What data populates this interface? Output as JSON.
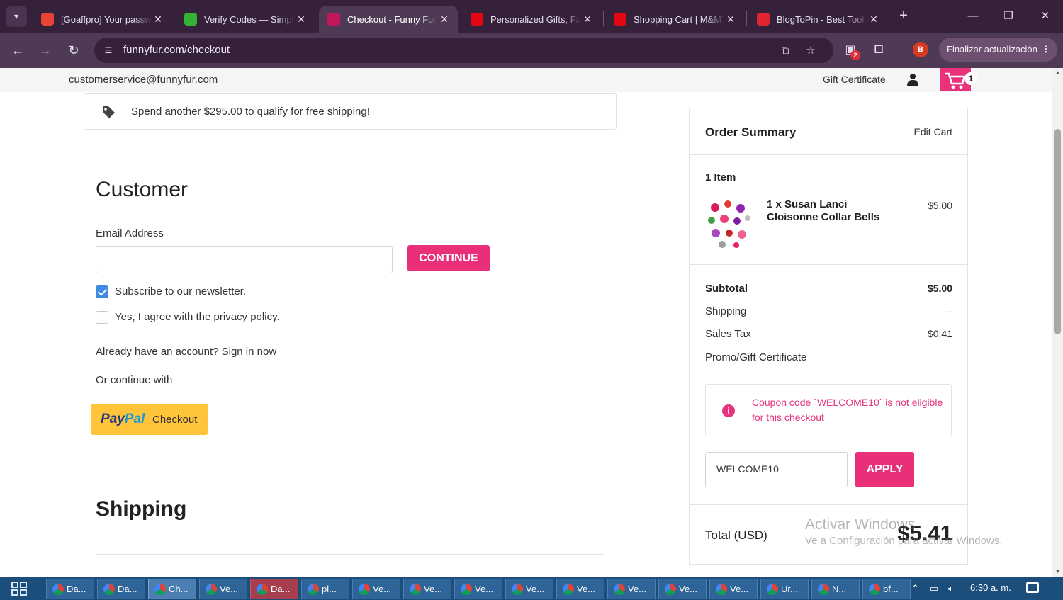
{
  "browser": {
    "tabs": [
      {
        "title": "[Goaffpro] Your password",
        "favicon": "gmail-icon",
        "color": "#ea4335",
        "active": false
      },
      {
        "title": "Verify Codes — SimplyCodes",
        "favicon": "simplycodes-icon",
        "color": "#34b233",
        "active": false
      },
      {
        "title": "Checkout - Funny Fur",
        "favicon": "funnyfur-icon",
        "color": "#c2185b",
        "active": true
      },
      {
        "title": "Personalized Gifts, Family",
        "favicon": "mm-icon",
        "color": "#e30613",
        "active": false
      },
      {
        "title": "Shopping Cart | M&M'S",
        "favicon": "mm-icon",
        "color": "#e30613",
        "active": false
      },
      {
        "title": "BlogToPin - Best Tool",
        "favicon": "blogtopin-icon",
        "color": "#e1252f",
        "active": false
      }
    ],
    "url": "funnyfur.com/checkout",
    "extension_badge": "2",
    "profile_initial": "B",
    "update_button": "Finalizar actualización"
  },
  "site": {
    "contact_email": "customerservice@funnyfur.com",
    "gift_certificate": "Gift Certificate",
    "cart_count": "1",
    "accent_color": "#ea2f7a"
  },
  "shipping_banner": "Spend another $295.00 to qualify for free shipping!",
  "customer": {
    "heading": "Customer",
    "email_label": "Email Address",
    "email_value": "",
    "continue_button": "CONTINUE",
    "newsletter_label": "Subscribe to our newsletter.",
    "newsletter_checked": true,
    "privacy_label": "Yes, I agree with the privacy policy.",
    "privacy_checked": false,
    "sign_in_text": "Already have an account? Sign in now",
    "continue_with": "Or continue with",
    "paypal_pay": "Pay",
    "paypal_pal": "Pal",
    "paypal_checkout": "Checkout"
  },
  "shipping": {
    "heading": "Shipping"
  },
  "order_summary": {
    "title": "Order Summary",
    "edit_cart": "Edit Cart",
    "item_count": "1 Item",
    "items": [
      {
        "name": "1 x Susan Lanci Cloisonne Collar Bells",
        "price": "$5.00"
      }
    ],
    "subtotal_label": "Subtotal",
    "subtotal_value": "$5.00",
    "shipping_label": "Shipping",
    "shipping_value": "--",
    "tax_label": "Sales Tax",
    "tax_value": "$0.41",
    "promo_label": "Promo/Gift Certificate",
    "coupon_error": "Coupon code `WELCOME10` is not eligible for this checkout",
    "promo_code": "WELCOME10",
    "apply_button": "APPLY",
    "total_label": "Total (USD)",
    "total_value": "$5.41"
  },
  "watermark": {
    "line1": "Activar Windows",
    "line2": "Ve a Configuración para activar Windows."
  },
  "taskbar": {
    "items": [
      {
        "label": "Da...",
        "highlight": false,
        "active": false
      },
      {
        "label": "Da...",
        "highlight": false,
        "active": false
      },
      {
        "label": "Ch...",
        "highlight": false,
        "active": true
      },
      {
        "label": "Ve...",
        "highlight": false,
        "active": false
      },
      {
        "label": "Da...",
        "highlight": true,
        "active": false
      },
      {
        "label": "pl...",
        "highlight": false,
        "active": false
      },
      {
        "label": "Ve...",
        "highlight": false,
        "active": false
      },
      {
        "label": "Ve...",
        "highlight": false,
        "active": false
      },
      {
        "label": "Ve...",
        "highlight": false,
        "active": false
      },
      {
        "label": "Ve...",
        "highlight": false,
        "active": false
      },
      {
        "label": "Ve...",
        "highlight": false,
        "active": false
      },
      {
        "label": "Ve...",
        "highlight": false,
        "active": false
      },
      {
        "label": "Ve...",
        "highlight": false,
        "active": false
      },
      {
        "label": "Ve...",
        "highlight": false,
        "active": false
      },
      {
        "label": "Ur...",
        "highlight": false,
        "active": false
      },
      {
        "label": "N...",
        "highlight": false,
        "active": false
      },
      {
        "label": "bf...",
        "highlight": false,
        "active": false
      }
    ],
    "clock": "6:30 a. m."
  }
}
